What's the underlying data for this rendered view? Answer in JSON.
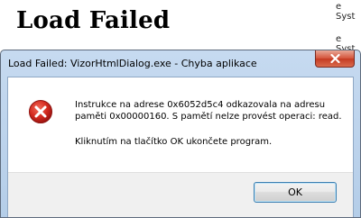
{
  "background": {
    "heading": "Load Failed",
    "side_text_1": "e Syst",
    "side_text_2": "e Syst"
  },
  "dialog": {
    "title": "Load Failed: VizorHtmlDialog.exe - Chyba aplikace",
    "icon": "error-icon",
    "message_line_1": "Instrukce na adrese 0x6052d5c4 odkazovala na adresu paměti 0x00000160. S pamětí nelze provést operaci: read.",
    "message_line_2": "Kliknutím na tlačítko OK ukončete program.",
    "ok_label": "OK",
    "close_icon": "close-icon"
  },
  "colors": {
    "title_bar": "#c6daf0",
    "close_button": "#c53a22",
    "error_icon": "#d42a1f",
    "ok_border": "#3c7fb1"
  }
}
